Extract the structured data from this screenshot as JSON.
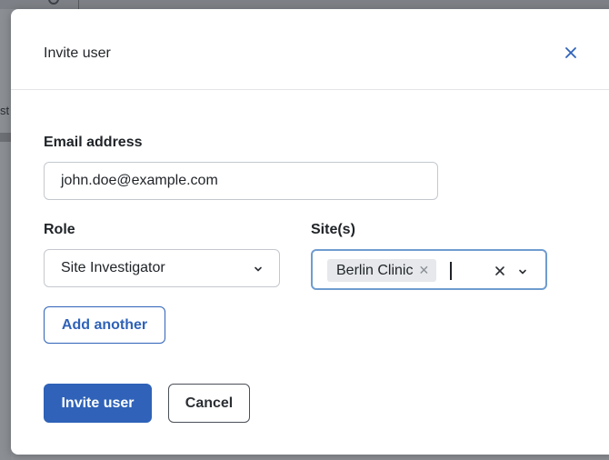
{
  "modal": {
    "title": "Invite user",
    "close_icon": "close-icon"
  },
  "form": {
    "email_label": "Email address",
    "email_value": "john.doe@example.com",
    "role_label": "Role",
    "role_value": "Site Investigator",
    "sites_label": "Site(s)",
    "sites_selected": [
      "Berlin Clinic"
    ],
    "add_another_label": "Add another"
  },
  "actions": {
    "invite_label": "Invite user",
    "cancel_label": "Cancel"
  },
  "background": {
    "left_text": "st"
  },
  "colors": {
    "primary": "#2f62b8",
    "focus_border": "#6f9ccf",
    "chip_bg": "#e6e8eb",
    "overlay": "#8f9297"
  }
}
